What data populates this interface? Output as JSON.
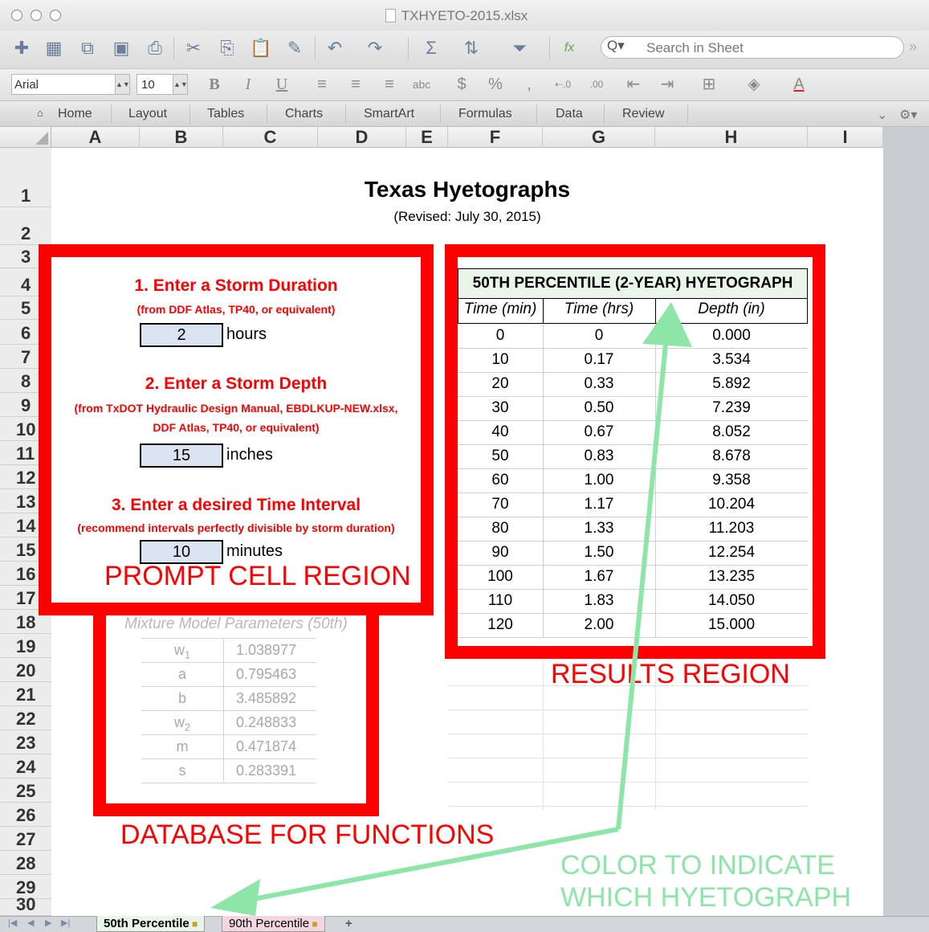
{
  "window": {
    "title": "TXHYETO-2015.xlsx"
  },
  "toolbar": {
    "search_placeholder": "Search in Sheet"
  },
  "format_bar": {
    "font": "Arial",
    "size": "10",
    "bold": "B",
    "italic": "I",
    "underline": "U",
    "currency": "$",
    "percent": "%",
    "comma": ",",
    "borders": "⊞",
    "font_color": "A"
  },
  "ribbon": {
    "tabs": [
      "Home",
      "Layout",
      "Tables",
      "Charts",
      "SmartArt",
      "Formulas",
      "Data",
      "Review"
    ]
  },
  "columns": [
    "A",
    "B",
    "C",
    "D",
    "E",
    "F",
    "G",
    "H",
    "I"
  ],
  "rows": [
    "1",
    "2",
    "3",
    "4",
    "5",
    "6",
    "7",
    "8",
    "9",
    "10",
    "11",
    "12",
    "13",
    "14",
    "15",
    "16",
    "17",
    "18",
    "19",
    "20",
    "21",
    "22",
    "23",
    "24",
    "25",
    "26",
    "27",
    "28",
    "29",
    "30"
  ],
  "sheet": {
    "title": "Texas Hyetographs",
    "subtitle": "(Revised: July 30, 2015)"
  },
  "prompt": {
    "step1_title": "1.  Enter a Storm Duration",
    "step1_note": "(from DDF Atlas, TP40, or equivalent)",
    "duration_value": "2",
    "duration_unit": "hours",
    "step2_title": "2.  Enter a Storm Depth",
    "step2_note_1": "(from TxDOT Hydraulic Design Manual, EBDLKUP-NEW.xlsx,",
    "step2_note_2": "DDF Atlas, TP40, or equivalent)",
    "depth_value": "15",
    "depth_unit": "inches",
    "step3_title": "3. Enter a desired Time Interval",
    "step3_note": "(recommend intervals perfectly divisible by storm duration)",
    "interval_value": "10",
    "interval_unit": "minutes",
    "region_label": "PROMPT CELL REGION"
  },
  "database": {
    "title": "Mixture Model Parameters (50th)",
    "params": [
      {
        "name": "w",
        "sub": "1",
        "value": "1.038977"
      },
      {
        "name": "a",
        "sub": "",
        "value": "0.795463"
      },
      {
        "name": "b",
        "sub": "",
        "value": "3.485892"
      },
      {
        "name": "w",
        "sub": "2",
        "value": "0.248833"
      },
      {
        "name": "m",
        "sub": "",
        "value": "0.471874"
      },
      {
        "name": "s",
        "sub": "",
        "value": "0.283391"
      }
    ],
    "region_label": "DATABASE FOR FUNCTIONS"
  },
  "results": {
    "title": "50TH PERCENTILE (2-YEAR) HYETOGRAPH",
    "headers": [
      "Time (min)",
      "Time (hrs)",
      "Depth (in)"
    ],
    "rows": [
      [
        "0",
        "0",
        "0.000"
      ],
      [
        "10",
        "0.17",
        "3.534"
      ],
      [
        "20",
        "0.33",
        "5.892"
      ],
      [
        "30",
        "0.50",
        "7.239"
      ],
      [
        "40",
        "0.67",
        "8.052"
      ],
      [
        "50",
        "0.83",
        "8.678"
      ],
      [
        "60",
        "1.00",
        "9.358"
      ],
      [
        "70",
        "1.17",
        "10.204"
      ],
      [
        "80",
        "1.33",
        "11.203"
      ],
      [
        "90",
        "1.50",
        "12.254"
      ],
      [
        "100",
        "1.67",
        "13.235"
      ],
      [
        "110",
        "1.83",
        "14.050"
      ],
      [
        "120",
        "2.00",
        "15.000"
      ]
    ],
    "region_label": "RESULTS REGION"
  },
  "annotation": {
    "line1": "COLOR TO INDICATE",
    "line2": "WHICH HYETOGRAPH",
    "color": "#8de6a8"
  },
  "sheet_tabs": [
    "50th Percentile",
    "90th Percentile"
  ],
  "colors": {
    "red_box": "#fe0000",
    "input_fill": "#dbe5f1",
    "title_fill": "#eaf5e9"
  }
}
